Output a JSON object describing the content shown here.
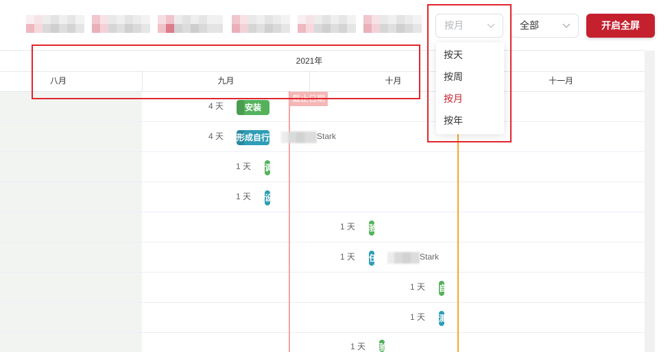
{
  "controls": {
    "view_select": {
      "value": "按月",
      "icon": "chevron-down-icon"
    },
    "filter_select": {
      "value": "全部",
      "icon": "chevron-down-icon"
    },
    "fullscreen_button": {
      "label": "开启全屏"
    }
  },
  "view_dropdown": {
    "options": [
      {
        "label": "按天"
      },
      {
        "label": "按周"
      },
      {
        "label": "按月",
        "selected": true
      },
      {
        "label": "按年"
      }
    ]
  },
  "timeline": {
    "year": "2021年",
    "months": [
      "八月",
      "九月",
      "十月",
      "十一月"
    ],
    "deadline_label": "截止日期"
  },
  "tasks": [
    {
      "duration": "4 天",
      "label": "安装",
      "bar_color": "green"
    },
    {
      "duration": "4 天",
      "label": "形成自行",
      "bar_color": "teal",
      "assignee": "Stark"
    },
    {
      "duration": "1 天",
      "label": "调",
      "bar_color": "green"
    },
    {
      "duration": "1 天",
      "label": "设",
      "bar_color": "teal"
    },
    {
      "duration": "1 天",
      "label": "验",
      "bar_color": "green"
    },
    {
      "duration": "1 天",
      "label": "任",
      "bar_color": "teal",
      "assignee": "Stark"
    },
    {
      "duration": "1 天",
      "label": "自",
      "bar_color": "green"
    },
    {
      "duration": "1 天",
      "label": "测",
      "bar_color": "teal"
    },
    {
      "duration": "1 天",
      "label": "验",
      "bar_color": "green"
    }
  ],
  "colors": {
    "accent": "#c5202e",
    "green": "#55b25b",
    "teal": "#2e9db6",
    "deadline_line": "#f4a3a3",
    "today_line": "#f5a623",
    "annotation": "#e0232b"
  }
}
